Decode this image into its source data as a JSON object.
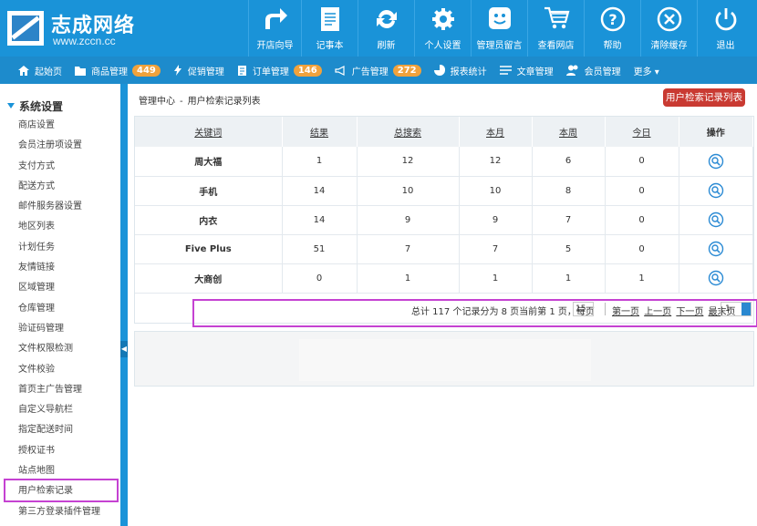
{
  "logo": {
    "title": "志成网络",
    "subtitle": "www.zccn.cc"
  },
  "top_buttons": [
    {
      "label": "开店向导",
      "icon": "arrow-icon"
    },
    {
      "label": "记事本",
      "icon": "notepad-icon"
    },
    {
      "label": "刷新",
      "icon": "refresh-icon"
    },
    {
      "label": "个人设置",
      "icon": "gear-icon"
    },
    {
      "label": "管理员留言",
      "icon": "smile-icon"
    },
    {
      "label": "查看网店",
      "icon": "cart-icon"
    },
    {
      "label": "帮助",
      "icon": "help-icon"
    },
    {
      "label": "清除缓存",
      "icon": "clear-icon"
    },
    {
      "label": "退出",
      "icon": "power-icon"
    }
  ],
  "nav": [
    {
      "label": "起始页",
      "icon": "home-icon"
    },
    {
      "label": "商品管理",
      "badge": "449",
      "icon": "folder-icon"
    },
    {
      "label": "促销管理",
      "icon": "bolt-icon"
    },
    {
      "label": "订单管理",
      "badge": "146",
      "icon": "clipboard-icon"
    },
    {
      "label": "广告管理",
      "badge": "272",
      "icon": "megaphone-icon"
    },
    {
      "label": "报表统计",
      "icon": "piechart-icon"
    },
    {
      "label": "文章管理",
      "icon": "list-icon"
    },
    {
      "label": "会员管理",
      "icon": "users-icon"
    },
    {
      "label": "更多 ▾",
      "icon": ""
    }
  ],
  "sidebar": {
    "section_title": "系统设置",
    "items": [
      "商店设置",
      "会员注册项设置",
      "支付方式",
      "配送方式",
      "邮件服务器设置",
      "地区列表",
      "计划任务",
      "友情链接",
      "区域管理",
      "仓库管理",
      "验证码管理",
      "文件权限检测",
      "文件校验",
      "首页主广告管理",
      "自定义导航栏",
      "指定配送时间",
      "授权证书",
      "站点地图",
      "用户检索记录",
      "第三方登录插件管理"
    ]
  },
  "breadcrumb": {
    "root": "管理中心",
    "sep": "-",
    "current": "用户检索记录列表"
  },
  "action_button": "用户检索记录列表",
  "table": {
    "headers": [
      "关键词",
      "结果",
      "总搜索",
      "本月",
      "本周",
      "今日",
      "操作"
    ],
    "rows": [
      [
        "周大福",
        "1",
        "12",
        "12",
        "6",
        "0"
      ],
      [
        "手机",
        "14",
        "10",
        "10",
        "8",
        "0"
      ],
      [
        "内衣",
        "14",
        "9",
        "9",
        "7",
        "0"
      ],
      [
        "Five Plus",
        "51",
        "7",
        "7",
        "5",
        "0"
      ],
      [
        "大商创",
        "0",
        "1",
        "1",
        "1",
        "1"
      ]
    ]
  },
  "pager": {
    "info": "总计 117 个记录分为 8 页当前第 1 页，每页",
    "per_page": "15",
    "first": "第一页",
    "prev": "上一页",
    "next": "下一页",
    "last": "最末页",
    "page": "1"
  },
  "colors": {
    "primary": "#1a93d8",
    "badge": "#f0a23c",
    "danger": "#c93a32",
    "highlight": "#c542d2"
  }
}
